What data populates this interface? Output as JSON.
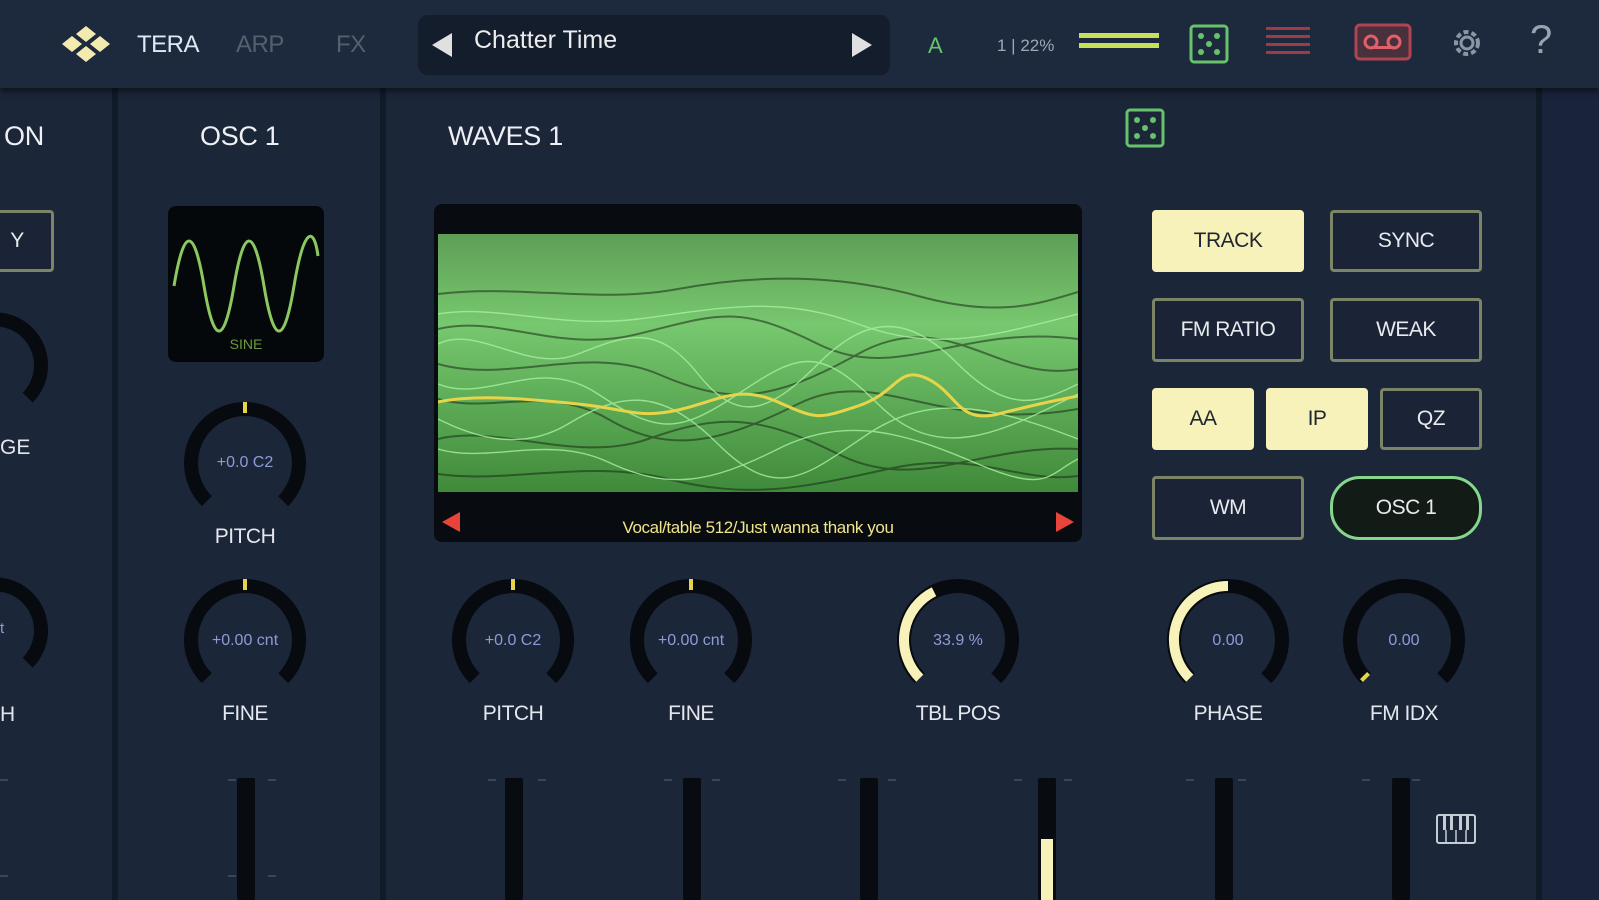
{
  "topbar": {
    "tabs": [
      {
        "label": "TERA",
        "active": true
      },
      {
        "label": "ARP",
        "active": false
      },
      {
        "label": "FX",
        "active": false
      }
    ],
    "preset_name": "Chatter Time",
    "ab_label": "A",
    "cpu_text": "1 | 22%",
    "icons": [
      "tera-logo-icon",
      "previous-arrow-icon",
      "next-arrow-icon",
      "level-meter-icon",
      "randomize-dice-icon",
      "keyboard-lines-icon",
      "recorder-icon",
      "gear-icon",
      "help-icon"
    ]
  },
  "left_panel": {
    "title_fragment": "ON",
    "button_fragment": "Y",
    "knob_labels": [
      "GE",
      "H"
    ],
    "knob_value_fragment": "t"
  },
  "osc1": {
    "title": "OSC 1",
    "wave_label": "SINE",
    "pitch_value": "+0.0 C2",
    "pitch_label": "PITCH",
    "fine_value": "+0.00 cnt",
    "fine_label": "FINE"
  },
  "waves1": {
    "title": "WAVES 1",
    "wavetable_name": "Vocal/table 512/Just wanna thank you",
    "buttons": {
      "track": {
        "label": "TRACK",
        "on": true
      },
      "sync": {
        "label": "SYNC",
        "on": false
      },
      "fm_ratio": {
        "label": "FM RATIO",
        "on": false
      },
      "weak": {
        "label": "WEAK",
        "on": false
      },
      "aa": {
        "label": "AA",
        "on": true
      },
      "ip": {
        "label": "IP",
        "on": true
      },
      "qz": {
        "label": "QZ",
        "on": false
      },
      "wm": {
        "label": "WM",
        "on": false
      },
      "osc1": {
        "label": "OSC 1",
        "on": true
      }
    },
    "knobs": {
      "pitch": {
        "value": "+0.0 C2",
        "label": "PITCH"
      },
      "fine": {
        "value": "+0.00 cnt",
        "label": "FINE"
      },
      "tbl_pos": {
        "value": "33.9 %",
        "label": "TBL POS",
        "level": 0.339
      },
      "phase": {
        "value": "0.00",
        "label": "PHASE"
      },
      "fm_idx": {
        "value": "0.00",
        "label": "FM IDX"
      }
    },
    "mod_slider_level": 0.5
  },
  "colors": {
    "background": "#1b2638",
    "topbar": "#1d2a3d",
    "accent_green": "#86d68c",
    "accent_cream": "#f7f2ba",
    "wave_yellow": "#e6d44a",
    "arrow_red": "#e8443a"
  }
}
